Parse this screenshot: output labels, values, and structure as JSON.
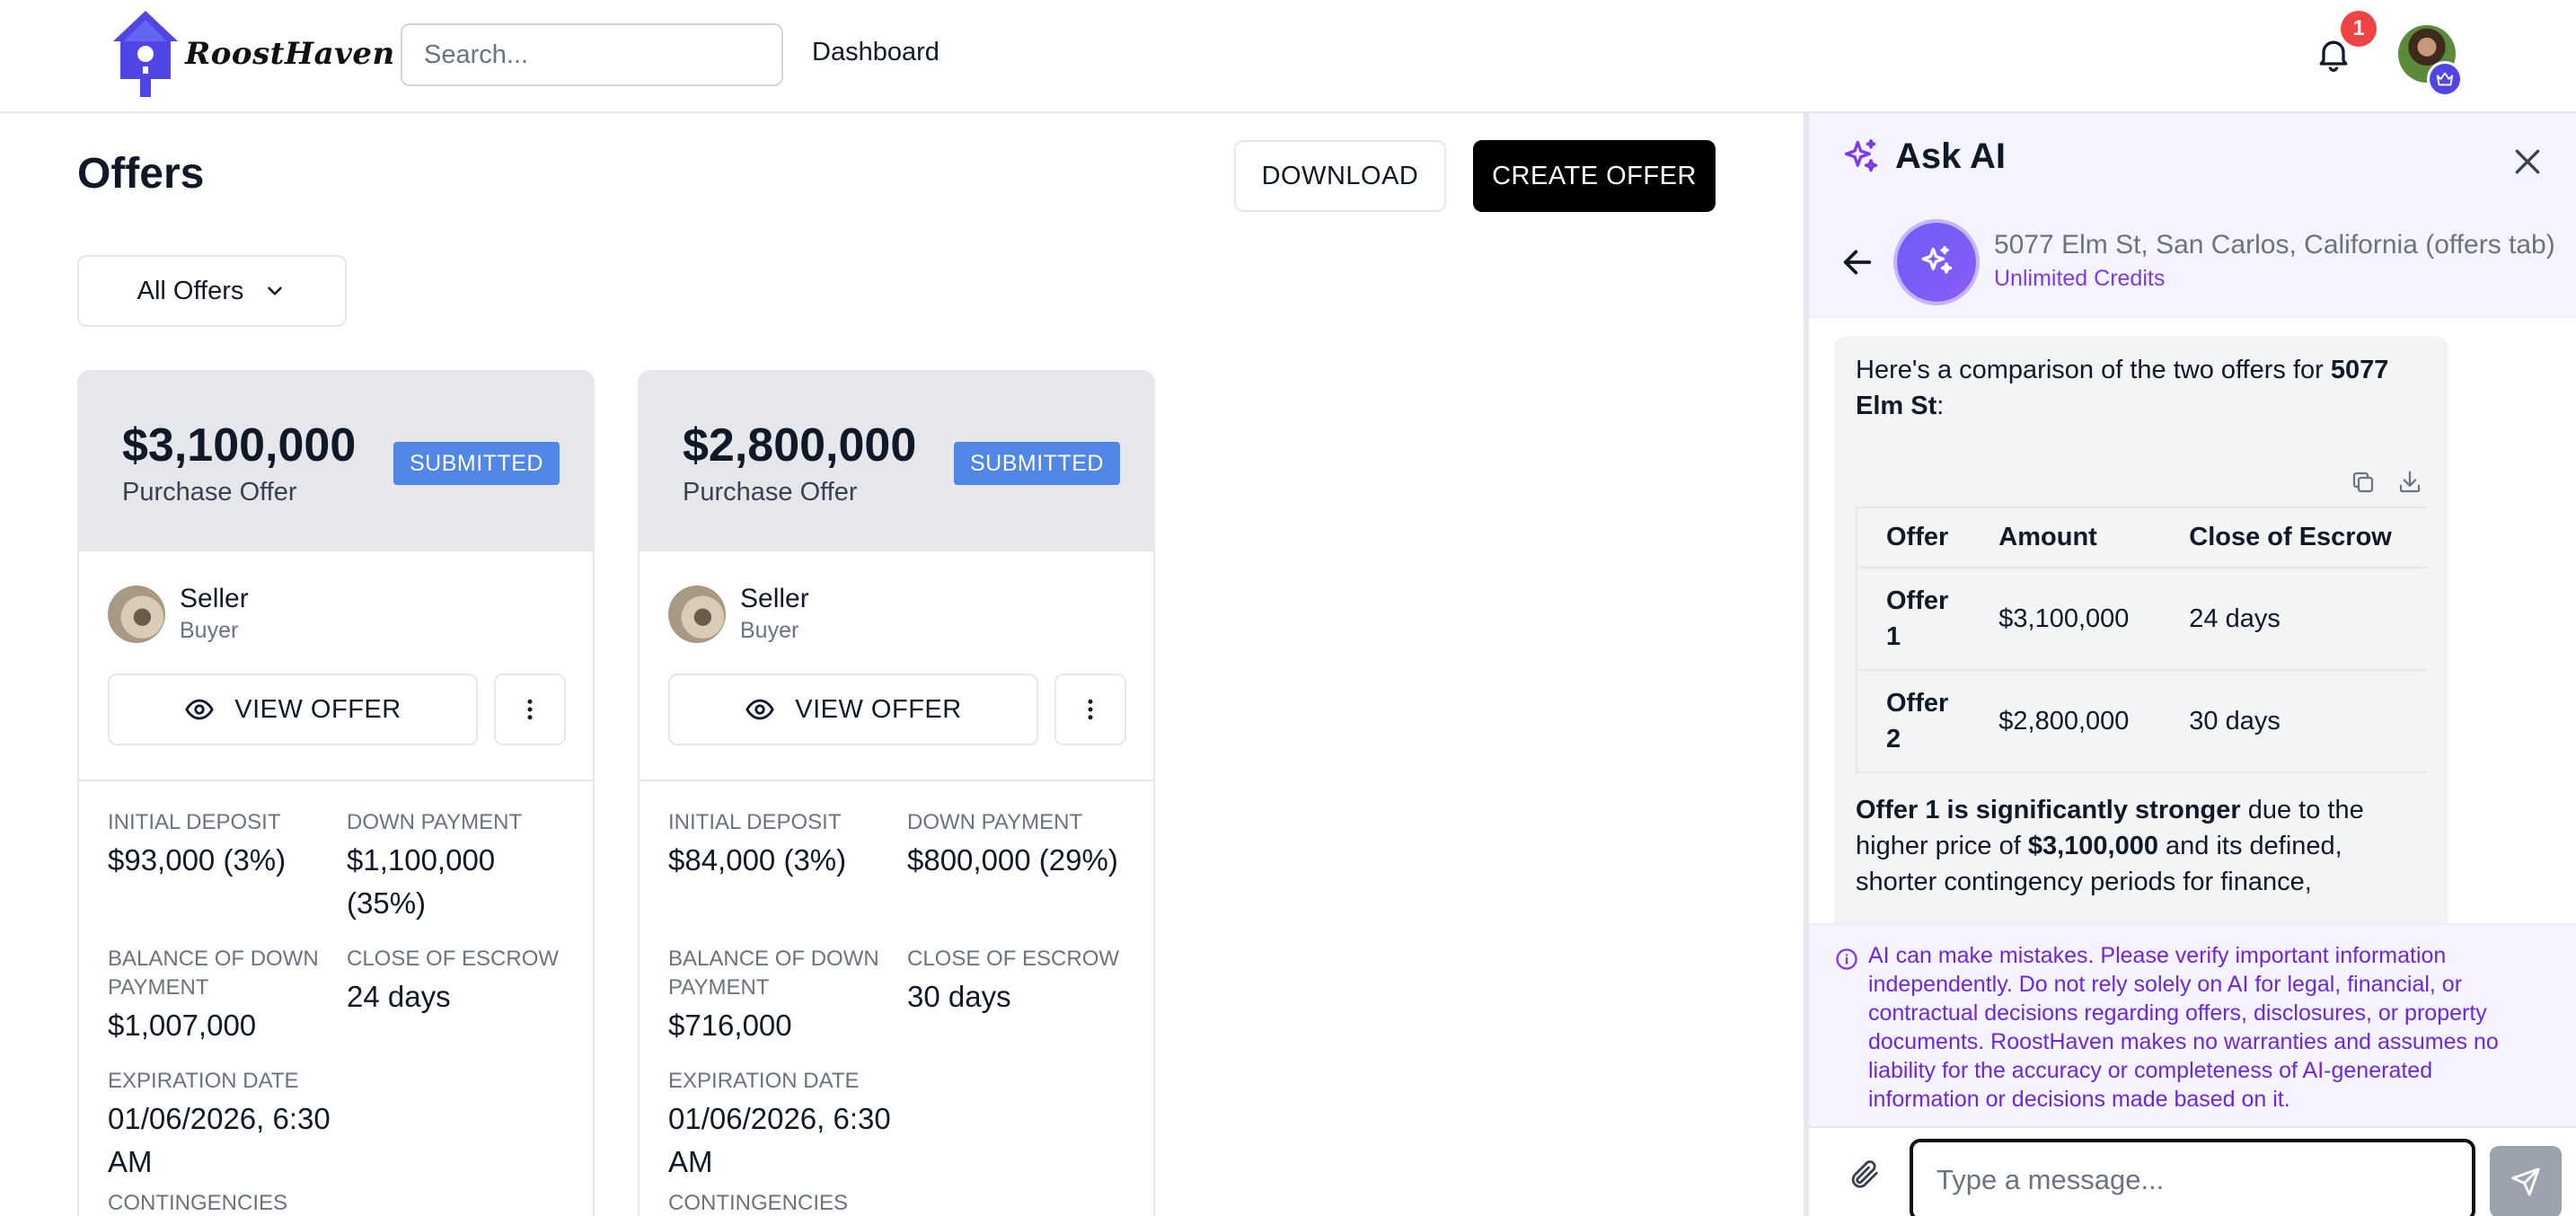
{
  "header": {
    "brand": "RoostHaven",
    "search_placeholder": "Search...",
    "nav_dashboard": "Dashboard",
    "notification_count": "1",
    "icons": [
      "birdhouse-logo-icon",
      "search-icon",
      "bell-icon",
      "crown-icon"
    ]
  },
  "main": {
    "title": "Offers",
    "download_label": "DOWNLOAD",
    "create_label": "CREATE OFFER",
    "filter_label": "All Offers",
    "cards": [
      {
        "amount": "$3,100,000",
        "offer_type": "Purchase Offer",
        "status": "SUBMITTED",
        "party_name": "Seller",
        "party_role": "Buyer",
        "view_label": "VIEW OFFER",
        "initial_deposit_label": "INITIAL DEPOSIT",
        "initial_deposit": "$93,000 (3%)",
        "down_payment_label": "DOWN PAYMENT",
        "down_payment": "$1,100,000 (35%)",
        "balance_label": "BALANCE OF DOWN PAYMENT",
        "balance": "$1,007,000",
        "escrow_label": "CLOSE OF ESCROW",
        "escrow": "24 days",
        "expiration_label": "EXPIRATION DATE",
        "expiration": "01/06/2026, 6:30 AM",
        "contingencies_label": "CONTINGENCIES"
      },
      {
        "amount": "$2,800,000",
        "offer_type": "Purchase Offer",
        "status": "SUBMITTED",
        "party_name": "Seller",
        "party_role": "Buyer",
        "view_label": "VIEW OFFER",
        "initial_deposit_label": "INITIAL DEPOSIT",
        "initial_deposit": "$84,000 (3%)",
        "down_payment_label": "DOWN PAYMENT",
        "down_payment": "$800,000 (29%)",
        "balance_label": "BALANCE OF DOWN PAYMENT",
        "balance": "$716,000",
        "escrow_label": "CLOSE OF ESCROW",
        "escrow": "30 days",
        "expiration_label": "EXPIRATION DATE",
        "expiration": "01/06/2026, 6:30 AM",
        "contingencies_label": "CONTINGENCIES"
      }
    ]
  },
  "ai_panel": {
    "title": "Ask AI",
    "context_title": "5077 Elm St, San Carlos, California (offers tab)",
    "credits": "Unlimited Credits",
    "message": {
      "intro_text": "Here's a comparison of the two offers for ",
      "intro_bold": "5077 Elm St",
      "intro_end": ":",
      "table_headers": [
        "Offer",
        "Amount",
        "Close of Escrow"
      ],
      "table_rows": [
        [
          "Offer 1",
          "$3,100,000",
          "24 days"
        ],
        [
          "Offer 2",
          "$2,800,000",
          "30 days"
        ]
      ],
      "conclusion_bold": "Offer 1 is significantly stronger",
      "conclusion_mid": " due to the higher price of ",
      "conclusion_price": "$3,100,000",
      "conclusion_end": " and its defined, shorter contingency periods for finance,"
    },
    "disclaimer": "AI can make mistakes. Please verify important information independently. Do not rely solely on AI for legal, financial, or contractual decisions regarding offers, disclosures, or property documents. RoostHaven makes no warranties and assumes no liability for the accuracy or completeness of AI-generated information or decisions made based on it.",
    "input_placeholder": "Type a message...",
    "accent_color": "#7c3aed"
  }
}
